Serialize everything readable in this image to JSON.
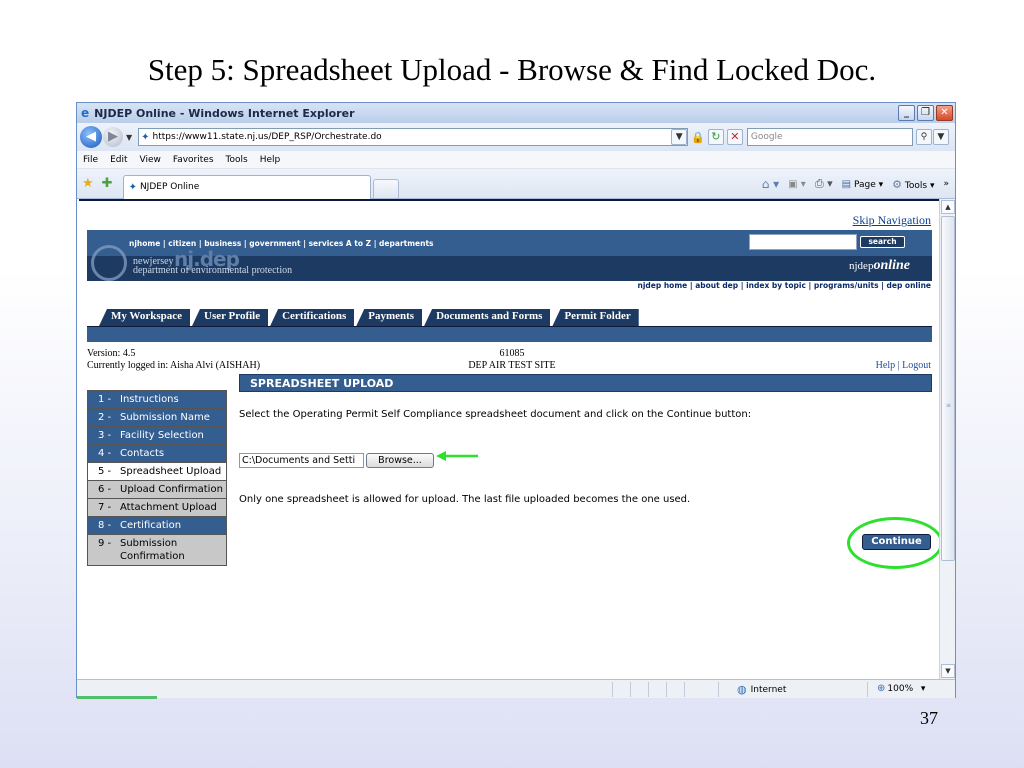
{
  "slide": {
    "title": "Step 5: Spreadsheet Upload - Browse & Find Locked Doc.",
    "page_number": "37"
  },
  "browser": {
    "window_title": "NJDEP Online - Windows Internet Explorer",
    "url": "https://www11.state.nj.us/DEP_RSP/Orchestrate.do",
    "search_placeholder": "Google",
    "menu": [
      "File",
      "Edit",
      "View",
      "Favorites",
      "Tools",
      "Help"
    ],
    "tab_title": "NJDEP Online",
    "command_bar": {
      "page": "Page",
      "tools": "Tools"
    },
    "status": {
      "zone": "Internet",
      "zoom": "100%"
    }
  },
  "site": {
    "skip_nav": "Skip Navigation",
    "top_nav": "njhome  |  citizen  |  business  |  government  |  services A to Z  |  departments",
    "search_button": "search",
    "logo_small": "newjersey",
    "logo_big": "nj.dep",
    "logo_sub": "department of environmental protection",
    "brand_prefix": "njdep",
    "brand_suffix": "online",
    "sub_nav": "njdep home  |  about dep  |  index by topic  |  programs/units  |  dep online",
    "tabs": [
      "My Workspace",
      "User Profile",
      "Certifications",
      "Payments",
      "Documents and Forms",
      "Permit Folder"
    ],
    "version": "Version: 4.5",
    "logged_in": "Currently logged in: Aisha Alvi (AISHAH)",
    "site_id": "61085",
    "site_name": "DEP AIR TEST SITE",
    "help_logout": "Help | Logout"
  },
  "upload": {
    "header": "SPREADSHEET UPLOAD",
    "instructions": "Select the Operating Permit Self Compliance spreadsheet document and click on the Continue button:",
    "file_value": "C:\\Documents and Setti",
    "browse_label": "Browse...",
    "note": "Only one spreadsheet is allowed for upload. The last file uploaded becomes the one used.",
    "continue_label": "Continue"
  },
  "steps": [
    {
      "num": "1 -",
      "label": "Instructions",
      "state": "done"
    },
    {
      "num": "2 -",
      "label": "Submission Name",
      "state": "done"
    },
    {
      "num": "3 -",
      "label": "Facility Selection",
      "state": "done"
    },
    {
      "num": "4 -",
      "label": "Contacts",
      "state": "done"
    },
    {
      "num": "5 -",
      "label": "Spreadsheet Upload",
      "state": "current"
    },
    {
      "num": "6 -",
      "label": "Upload Confirmation",
      "state": "future"
    },
    {
      "num": "7 -",
      "label": "Attachment Upload",
      "state": "future"
    },
    {
      "num": "8 -",
      "label": "Certification",
      "state": "done"
    },
    {
      "num": "9 -",
      "label": "Submission Confirmation",
      "state": "future"
    }
  ],
  "colors": {
    "highlight": "#2ee02e",
    "nav_blue": "#345e90",
    "nav_dark": "#1c3a62"
  }
}
